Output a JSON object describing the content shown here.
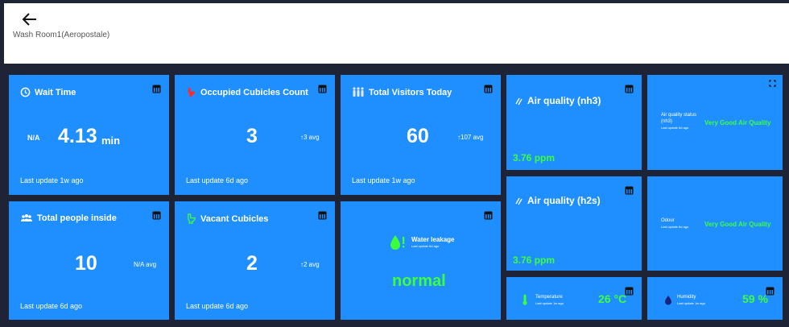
{
  "header": {
    "title": "Wash Room1(Aeropostale)"
  },
  "cards": {
    "wait_time": {
      "title": "Wait Time",
      "left_value": "N/A",
      "value": "4.13",
      "unit": "min",
      "footer": "Last update 1w ago"
    },
    "occupied": {
      "title": "Occupied Cubicles Count",
      "value": "3",
      "avg": "3 avg",
      "footer": "Last update 6d ago"
    },
    "visitors": {
      "title": "Total Visitors Today",
      "value": "60",
      "avg": "107 avg",
      "footer": "Last update 1w ago"
    },
    "nh3": {
      "title": "Air quality (nh3)",
      "value": "3.76 ppm"
    },
    "nh3_status": {
      "label": "Air quality status (nh3)",
      "sub": "Last update 6d ago",
      "value": "Very Good Air Quality"
    },
    "people": {
      "title": "Total people inside",
      "value": "10",
      "avg": "N/A avg",
      "footer": "Last update 6d ago"
    },
    "vacant": {
      "title": "Vacant Cubicles",
      "value": "2",
      "avg": "2 avg",
      "footer": "Last update 6d ago"
    },
    "leakage": {
      "label": "Water leakage",
      "sub": "Last update 6d ago",
      "value": "normal"
    },
    "h2s": {
      "title": "Air quality (h2s)",
      "value": "3.76 ppm"
    },
    "odour": {
      "label": "Odour",
      "sub": "Last update 6d ago",
      "value": "Very Good Air Quality"
    },
    "temperature": {
      "label": "Temperature",
      "sub": "Last update 1w ago",
      "value": "26 °C"
    },
    "humidity": {
      "label": "Humidity",
      "sub": "Last update 1w ago",
      "value": "59 %"
    }
  },
  "colors": {
    "card": "#1f8fff",
    "background": "#1e2436",
    "status_green": "#3cff3c",
    "header": "#ffffff"
  },
  "icons": [
    "back-arrow-icon",
    "clock-icon",
    "toilet-icon",
    "visitors-icon",
    "air-icon",
    "people-icon",
    "water-drop-icon",
    "thermometer-icon",
    "humidity-drop-icon",
    "table-icon",
    "expand-icon"
  ]
}
